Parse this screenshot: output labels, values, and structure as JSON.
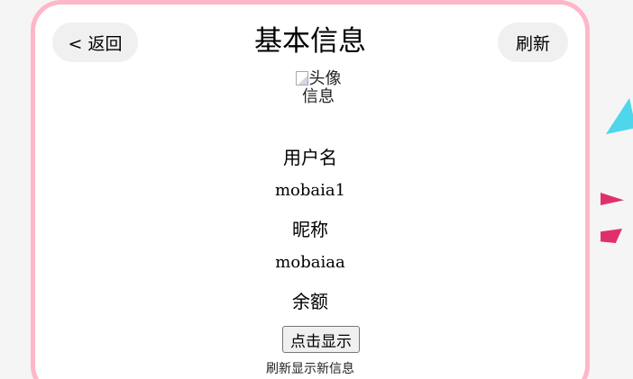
{
  "header": {
    "back_label": "< 返回",
    "title": "基本信息",
    "refresh_label": "刷新"
  },
  "avatar": {
    "alt_text": "头像信息"
  },
  "profile": {
    "username_label": "用户名",
    "username_value": "mobaia1",
    "nickname_label": "昵称",
    "nickname_value": "mobaiaa",
    "balance_label": "余额",
    "show_button_label": "点击显示",
    "hint": "刷新显示新信息"
  },
  "colors": {
    "card_border": "#ffb6c8",
    "button_bg": "#f0f0f0",
    "accent_cyan": "#4ed6ea",
    "accent_pink": "#e0306a"
  },
  "icons": {
    "avatar": "broken-image-icon"
  }
}
